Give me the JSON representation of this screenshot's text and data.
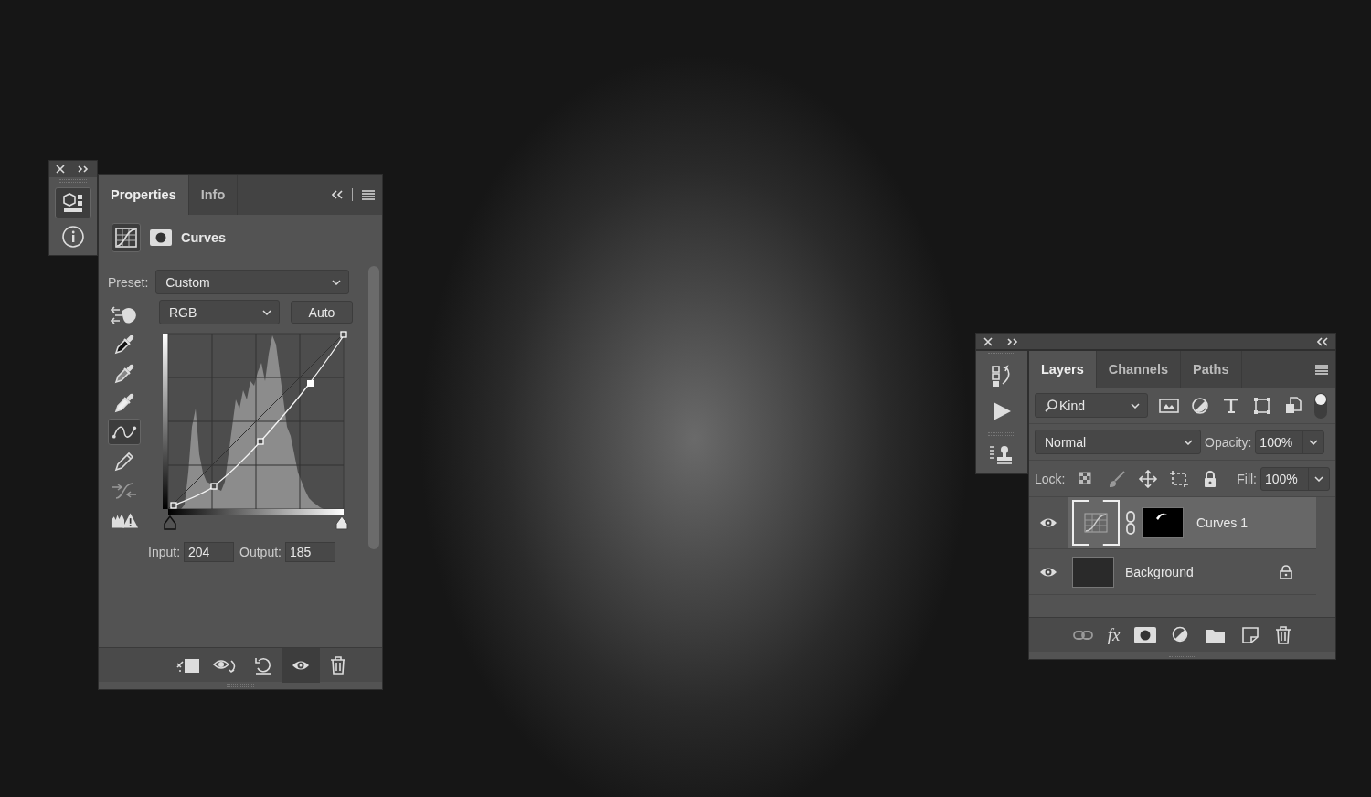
{
  "properties_dock": [
    {
      "kind": "properties",
      "selected": true
    },
    {
      "kind": "info",
      "selected": false
    }
  ],
  "properties_panel": {
    "tabs": [
      {
        "label": "Properties",
        "selected": true
      },
      {
        "label": "Info",
        "selected": false
      }
    ],
    "title": "Curves",
    "preset_label": "Preset:",
    "preset": "Custom",
    "channel": "RGB",
    "auto_button": "Auto",
    "tools": [
      {
        "kind": "target",
        "selected": false
      },
      {
        "kind": "black-dropper",
        "selected": false
      },
      {
        "kind": "gray-dropper",
        "selected": false
      },
      {
        "kind": "white-dropper",
        "selected": false
      },
      {
        "kind": "curve",
        "selected": true
      },
      {
        "kind": "pencil",
        "selected": false
      },
      {
        "kind": "smooth",
        "selected": false
      },
      {
        "kind": "clipping",
        "selected": false
      }
    ],
    "black_point": {
      "level": 0
    },
    "white_point": {
      "level": 1
    },
    "input_label": "Input:",
    "input": "204",
    "output_label": "Output:",
    "output": "185",
    "footer": [
      {
        "kind": "clip",
        "selected": false
      },
      {
        "kind": "previous",
        "selected": false
      },
      {
        "kind": "reset",
        "selected": false
      },
      {
        "kind": "eye",
        "selected": true
      },
      {
        "kind": "trash",
        "selected": false
      }
    ]
  },
  "layers_dock": [
    {
      "kind": "history"
    },
    {
      "kind": "actions"
    },
    {
      "kind": "clone"
    }
  ],
  "layers_panel": {
    "tabs": [
      {
        "label": "Layers",
        "selected": true
      },
      {
        "label": "Channels",
        "selected": false
      },
      {
        "label": "Paths",
        "selected": false
      }
    ],
    "filter": "Kind",
    "filter_on": true,
    "blend_mode": "Normal",
    "opacity_label": "Opacity:",
    "opacity": "100%",
    "lock_label": "Lock:",
    "fill_label": "Fill:",
    "fill": "100%",
    "layers": [
      {
        "name": "Curves 1",
        "kind": "adjustment",
        "selected": true,
        "visible": true,
        "locked": false
      },
      {
        "name": "Background",
        "kind": "image",
        "selected": false,
        "visible": true,
        "locked": true
      }
    ],
    "fx_button": "fx"
  }
}
